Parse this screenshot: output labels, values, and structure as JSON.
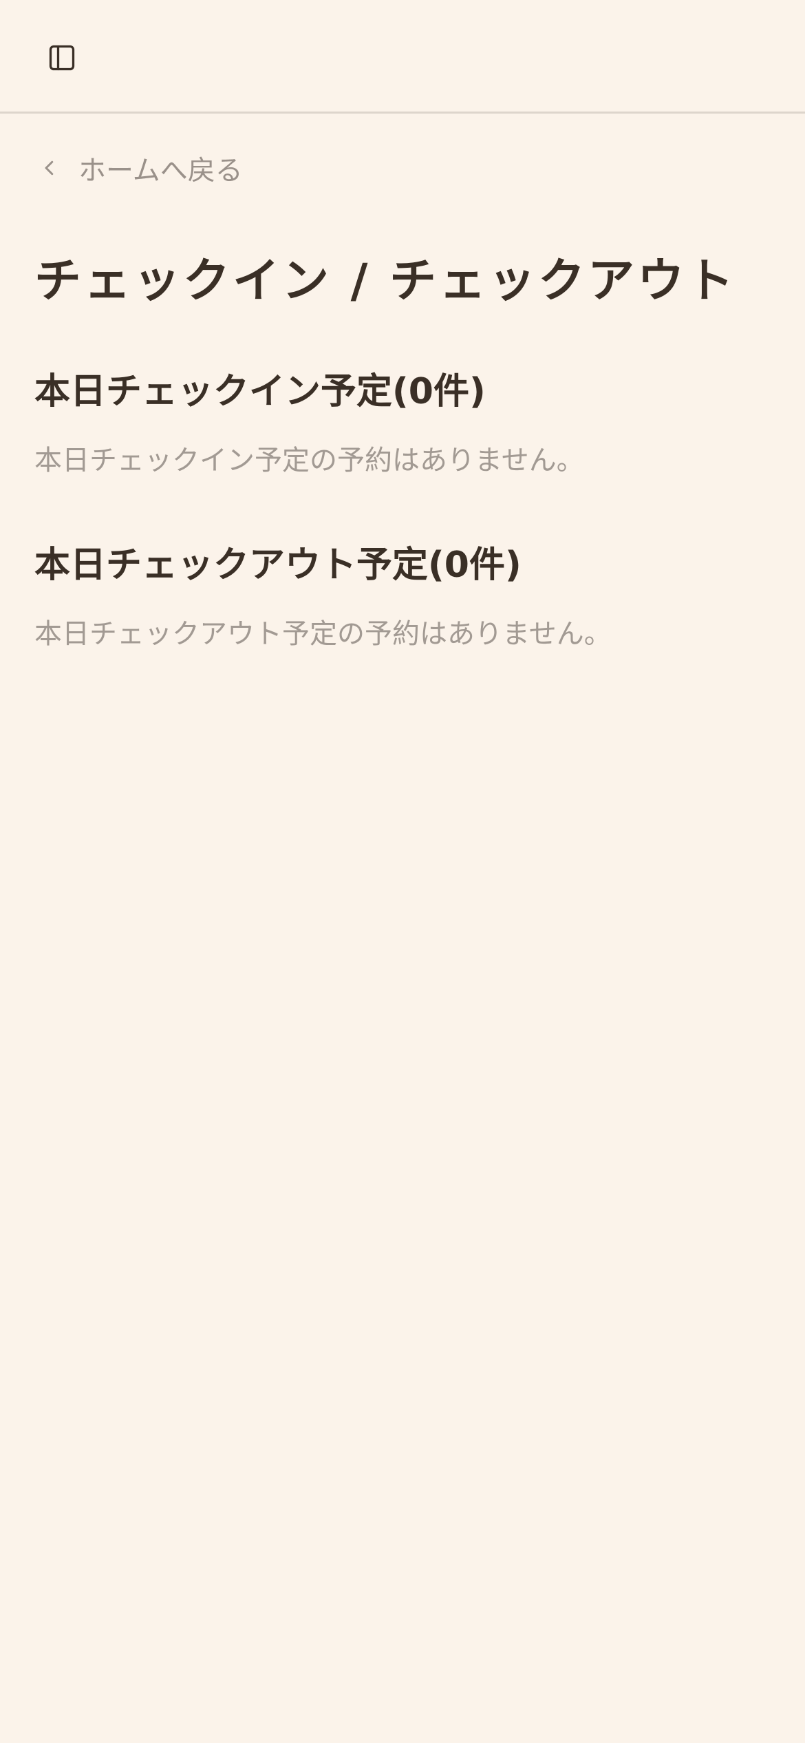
{
  "topbar": {
    "toggle_icon": "sidebar-panel-icon"
  },
  "nav": {
    "back_label": "ホームへ戻る",
    "back_icon": "chevron-left-icon"
  },
  "page": {
    "title": "チェックイン / チェックアウト"
  },
  "sections": {
    "checkin": {
      "heading": "本日チェックイン予定(0件)",
      "empty_message": "本日チェックイン予定の予約はありません。"
    },
    "checkout": {
      "heading": "本日チェックアウト予定(0件)",
      "empty_message": "本日チェックアウト予定の予約はありません。"
    }
  },
  "colors": {
    "background": "#fbf3ea",
    "text": "#3a2f26",
    "muted_text": "#9a918a",
    "divider": "#ddd5cc"
  }
}
